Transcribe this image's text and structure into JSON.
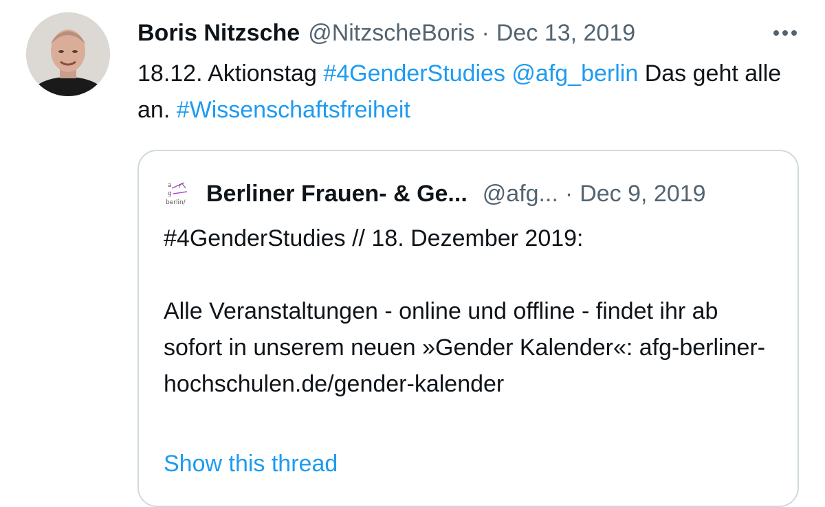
{
  "tweet": {
    "author": {
      "display_name": "Boris Nitzsche",
      "handle": "@NitzscheBoris",
      "avatar_icon": "profile-photo"
    },
    "separator": "·",
    "date": "Dec 13, 2019",
    "more_icon": "more-icon",
    "text": {
      "part1": "18.12. Aktionstag ",
      "hashtag1": "#4GenderStudies",
      "space1": " ",
      "mention": "@afg_berlin",
      "part2": " Das geht alle an. ",
      "hashtag2": "#Wissenschaftsfreiheit"
    },
    "quote": {
      "author": {
        "display_name": "Berliner Frauen- & Ge...",
        "handle": "@afg...",
        "avatar_icon": "afg-logo",
        "avatar_text": "berlin/"
      },
      "separator": "·",
      "date": "Dec 9, 2019",
      "lines": {
        "line1": "#4GenderStudies // 18. Dezember 2019:",
        "line2": "Alle Veranstaltungen - online und offline - findet ihr ab sofort in unserem neuen »Gender Kalender«: afg-berliner-hochschulen.de/gender-kalender"
      },
      "show_thread": "Show this thread"
    }
  },
  "colors": {
    "text": "#0f1419",
    "secondary": "#536471",
    "link": "#1d9bf0",
    "border": "#cfd9de"
  }
}
